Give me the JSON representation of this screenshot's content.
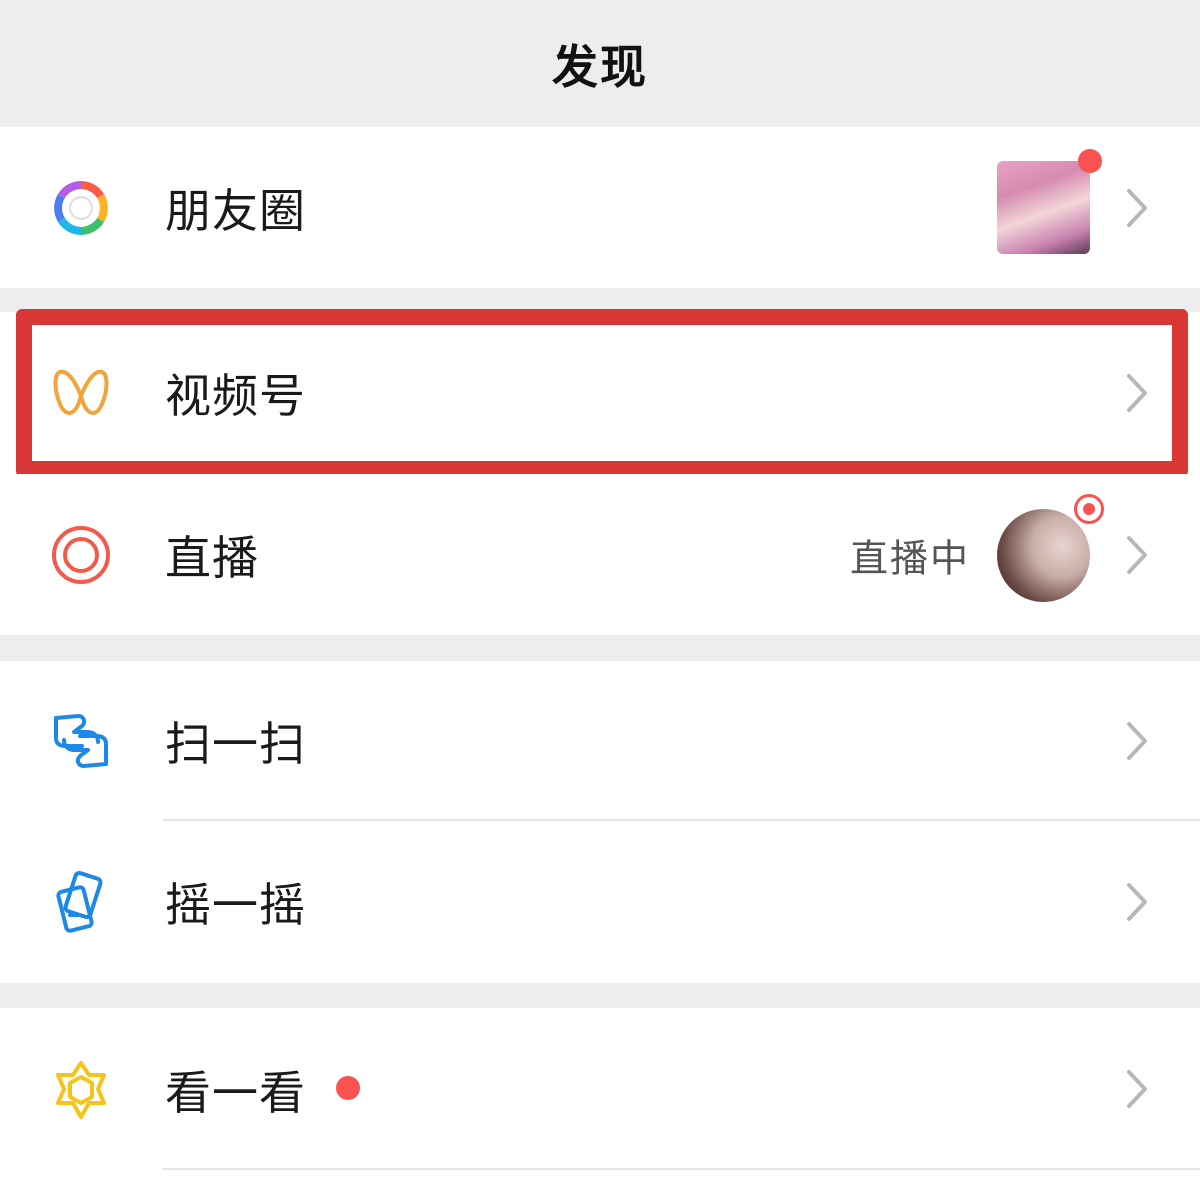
{
  "header": {
    "title": "发现"
  },
  "rows": {
    "moments": {
      "label": "朋友圈",
      "icon": "moments-aperture-icon"
    },
    "channels": {
      "label": "视频号",
      "icon": "channels-icon"
    },
    "live": {
      "label": "直播",
      "status": "直播中",
      "icon": "live-icon"
    },
    "scan": {
      "label": "扫一扫",
      "icon": "scan-icon"
    },
    "shake": {
      "label": "摇一摇",
      "icon": "shake-icon"
    },
    "top_stories": {
      "label": "看一看",
      "icon": "top-stories-icon"
    }
  },
  "colors": {
    "accent_red": "#fa5151",
    "highlight_border": "#d93636",
    "channels_orange": "#f2a33a",
    "live_red": "#f25a4c",
    "scan_blue": "#1e88e5",
    "top_stories_yellow": "#f7c21a"
  }
}
